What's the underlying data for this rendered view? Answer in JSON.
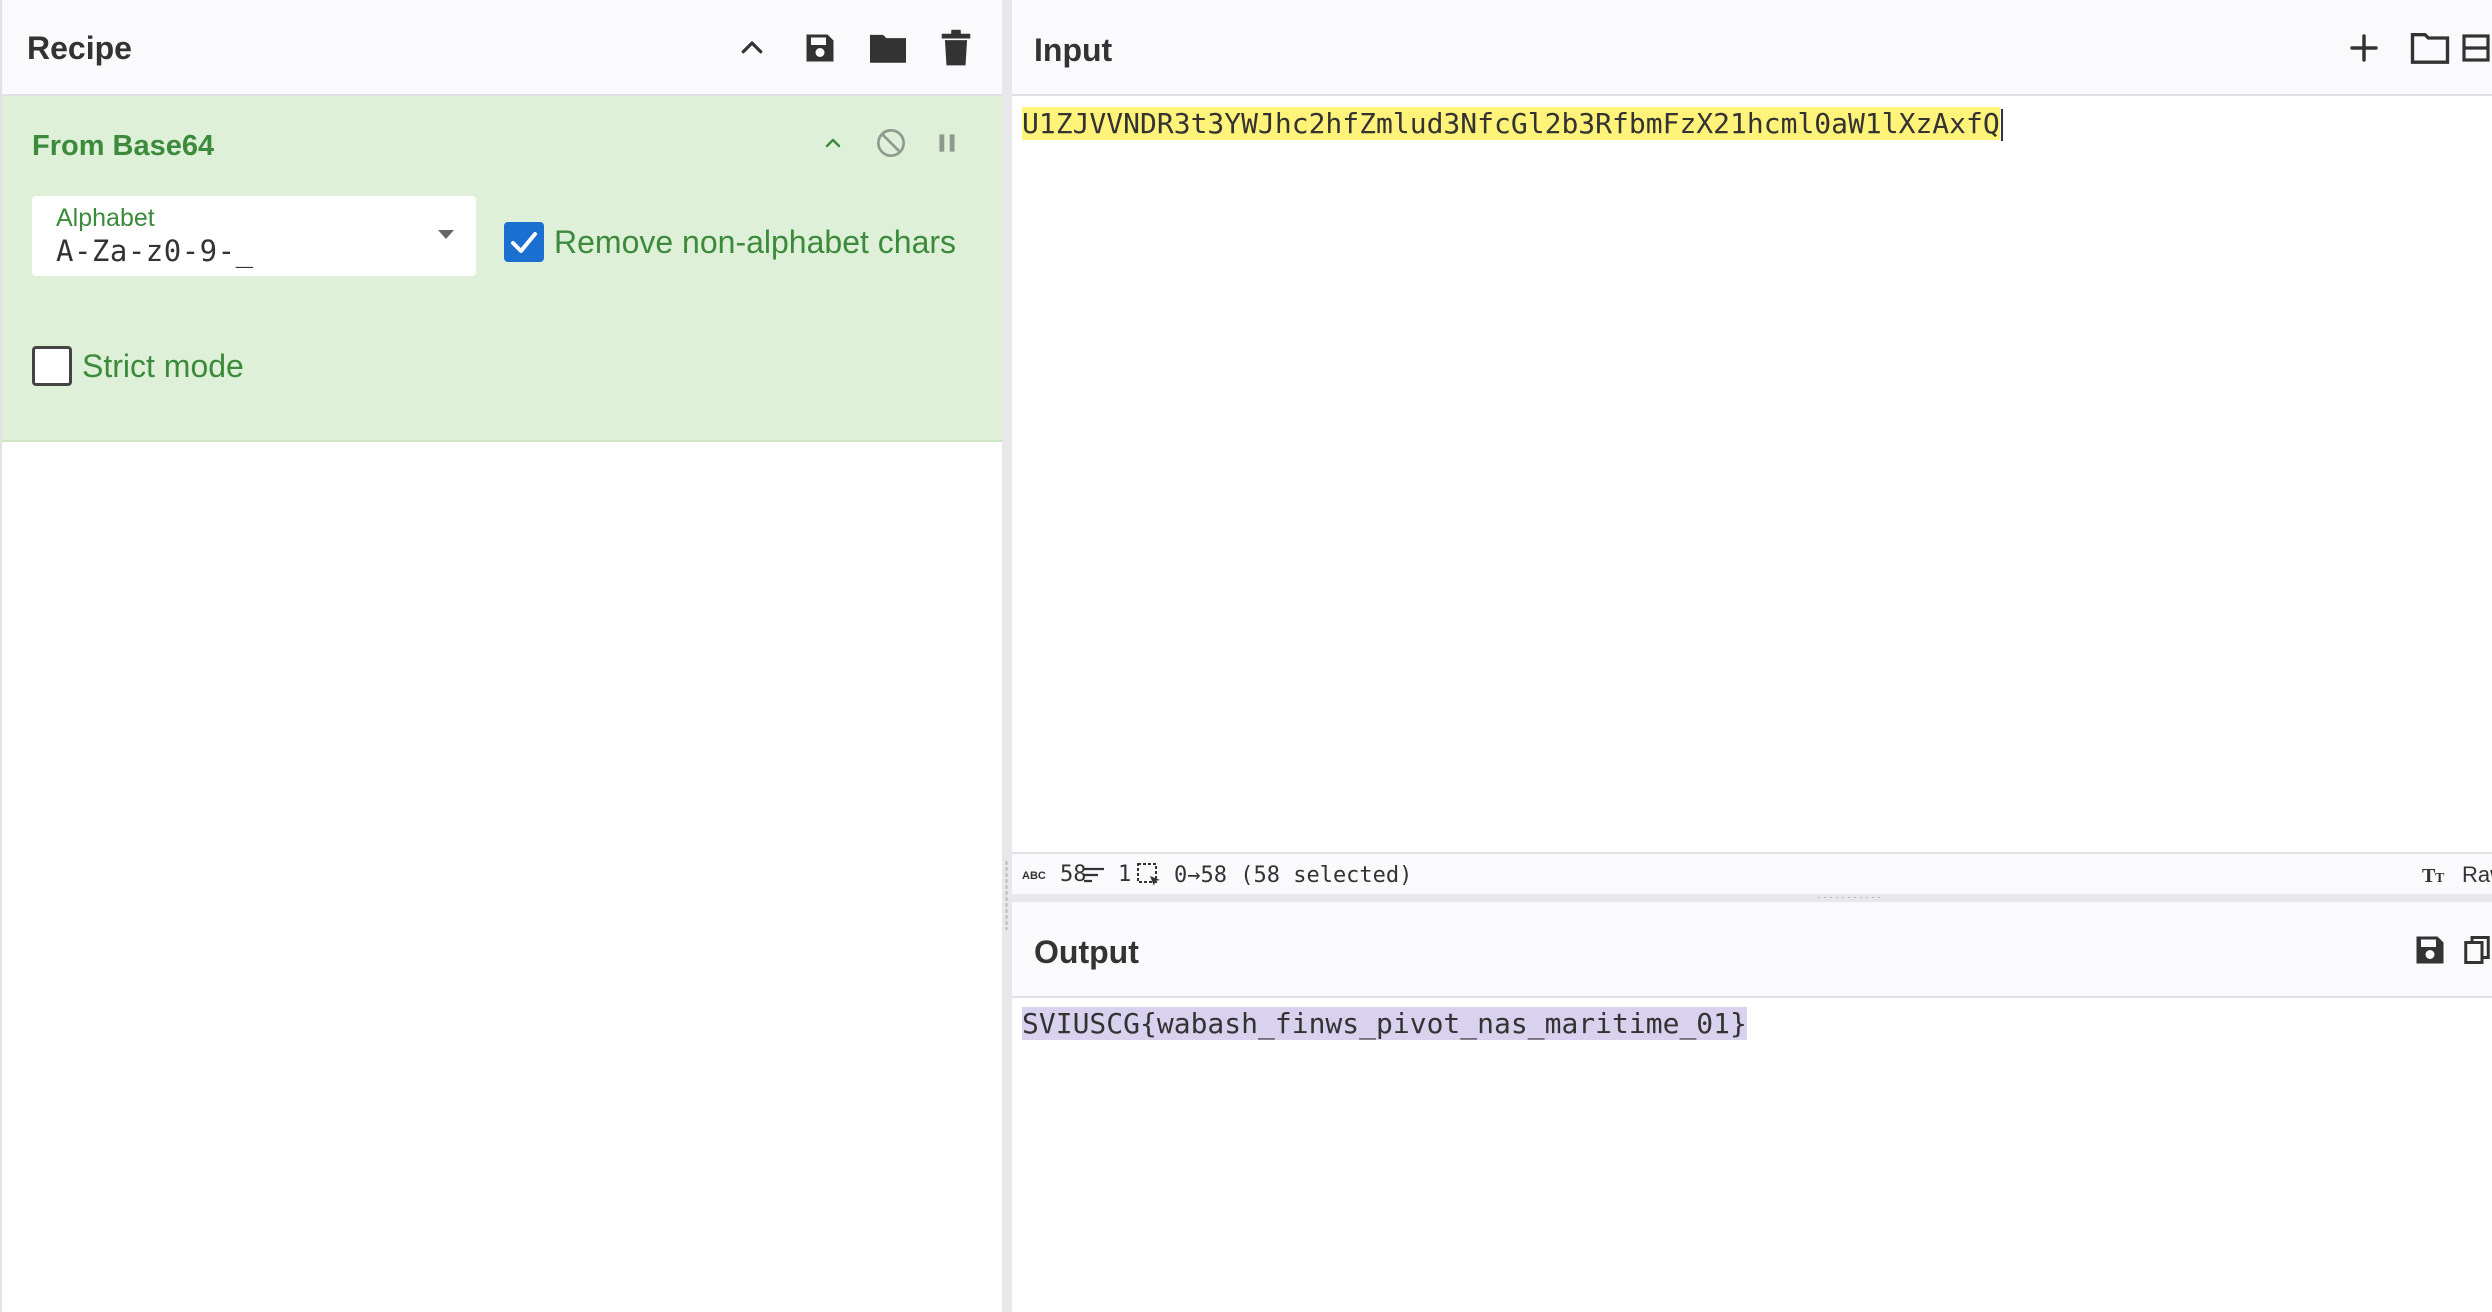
{
  "recipe": {
    "title": "Recipe",
    "operation": {
      "title": "From Base64",
      "alphabet_label": "Alphabet",
      "alphabet_value": "A-Za-z0-9-_",
      "remove_non_alphabet_label": "Remove non-alphabet chars",
      "remove_non_alphabet_checked": true,
      "strict_mode_label": "Strict mode",
      "strict_mode_checked": false
    }
  },
  "input": {
    "title": "Input",
    "text": "U1ZJVVNDR3t3YWJhc2hfZmlud3NfcGl2b3RfbmFzX21hcml0aW1lXzAxfQ",
    "status": {
      "length": "58",
      "lines": "1",
      "selection": "0→58 (58 selected)",
      "format": "Raw"
    }
  },
  "output": {
    "title": "Output",
    "text": "SVIUSCG{wabash_finws_pivot_nas_maritime_01}"
  },
  "icons": {
    "collapse": "chevron-up-icon",
    "save": "save-icon",
    "open": "folder-icon",
    "delete": "trash-icon",
    "disable": "disable-icon",
    "pause": "pause-icon",
    "add": "plus-icon",
    "copy": "copy-icon"
  },
  "colors": {
    "operation_bg": "#dff0d8",
    "operation_text": "#3c8a3c",
    "input_highlight": "#fff37a",
    "output_highlight": "#d8d2ef",
    "checkbox_on": "#1a6fd1"
  }
}
